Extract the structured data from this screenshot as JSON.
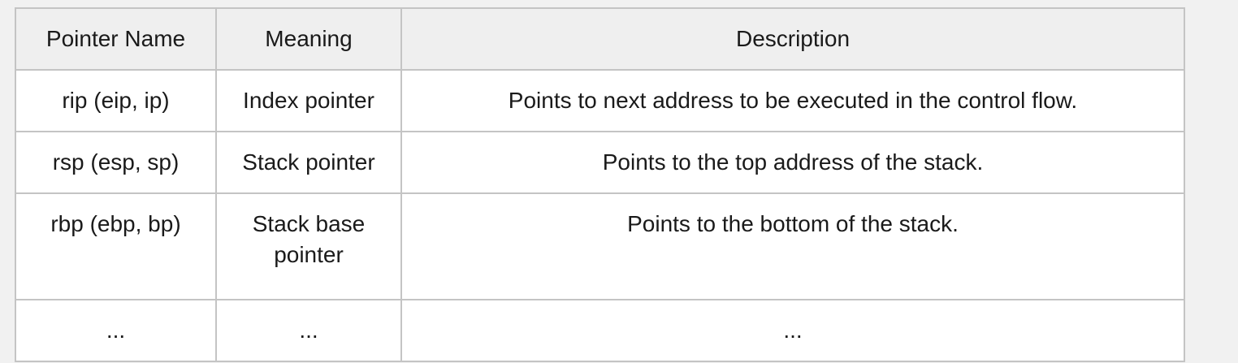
{
  "table": {
    "headers": {
      "name": "Pointer Name",
      "meaning": "Meaning",
      "description": "Description"
    },
    "rows": [
      {
        "name": "rip (eip, ip)",
        "meaning": "Index pointer",
        "description": "Points to next address to be executed in the control flow."
      },
      {
        "name": "rsp (esp, sp)",
        "meaning": "Stack pointer",
        "description": "Points to the top address of the stack."
      },
      {
        "name": "rbp (ebp, bp)",
        "meaning": "Stack base pointer",
        "description": "Points to the bottom of the stack."
      },
      {
        "name": "...",
        "meaning": "...",
        "description": "..."
      }
    ]
  }
}
